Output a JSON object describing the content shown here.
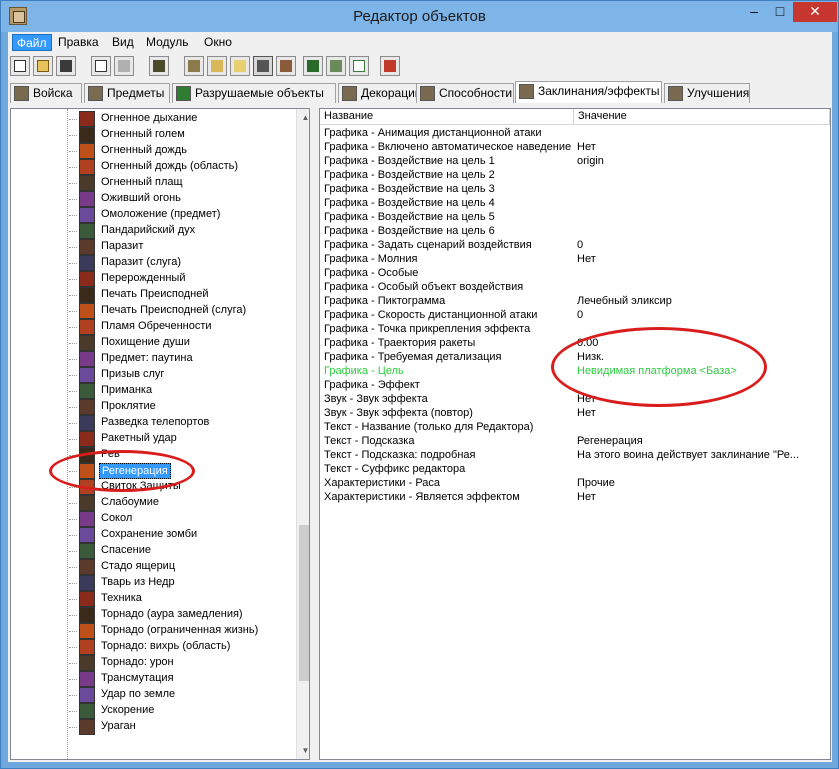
{
  "window": {
    "title": "Редактор объектов",
    "minimize": "–",
    "maximize": "□",
    "close": "✕"
  },
  "menu": [
    "Файл",
    "Правка",
    "Вид",
    "Модуль",
    "Окно"
  ],
  "toolbar_icons": [
    "new-icon",
    "open-icon",
    "save-icon",
    "copy-icon",
    "paste-icon",
    "units-icon",
    "terrain-icon",
    "script-icon",
    "sound-icon",
    "object-icon",
    "import-icon",
    "trigger-icon",
    "add-icon",
    "test-map-icon"
  ],
  "tabs": [
    {
      "label": "Войска",
      "icon": "units-tab-icon"
    },
    {
      "label": "Предметы",
      "icon": "items-tab-icon"
    },
    {
      "label": "Разрушаемые объекты",
      "icon": "destructibles-tab-icon"
    },
    {
      "label": "Декорации",
      "icon": "doodads-tab-icon"
    },
    {
      "label": "Способности",
      "icon": "abilities-tab-icon"
    },
    {
      "label": "Заклинания/эффекты",
      "icon": "buffs-tab-icon"
    },
    {
      "label": "Улучшения",
      "icon": "upgrades-tab-icon"
    }
  ],
  "selected_tab": 5,
  "tree": {
    "items": [
      "Огненное дыхание",
      "Огненный голем",
      "Огненный дождь",
      "Огненный дождь (область)",
      "Огненный плащ",
      "Оживший огонь",
      "Омоложение (предмет)",
      "Пандарийский дух",
      "Паразит",
      "Паразит (слуга)",
      "Перерожденный",
      "Печать Преисподней",
      "Печать Преисподней (слуга)",
      "Пламя Обреченности",
      "Похищение души",
      "Предмет: паутина",
      "Призыв слуг",
      "Приманка",
      "Проклятие",
      "Разведка телепортов",
      "Ракетный удар",
      "Рев",
      "Регенерация",
      "Свиток Защиты",
      "Слабоумие",
      "Сокол",
      "Сохранение зомби",
      "Спасение",
      "Стадо ящериц",
      "Тварь из Недр",
      "Техника",
      "Торнадо (аура замедления)",
      "Торнадо (ограниченная жизнь)",
      "Торнадо: вихрь (область)",
      "Торнадо: урон",
      "Трансмутация",
      "Удар по земле",
      "Ускорение",
      "Ураган"
    ],
    "selected_index": 22,
    "scroll_up": "▲",
    "scroll_down": "▼"
  },
  "table": {
    "columns": [
      "Название",
      "Значение"
    ],
    "rows": [
      {
        "name": "Графика - Анимация дистанционной атаки",
        "value": ""
      },
      {
        "name": "Графика - Включено автоматическое наведение",
        "value": "Нет"
      },
      {
        "name": "Графика - Воздействие на цель 1",
        "value": "origin"
      },
      {
        "name": "Графика - Воздействие на цель 2",
        "value": ""
      },
      {
        "name": "Графика - Воздействие на цель 3",
        "value": ""
      },
      {
        "name": "Графика - Воздействие на цель 4",
        "value": ""
      },
      {
        "name": "Графика - Воздействие на цель 5",
        "value": ""
      },
      {
        "name": "Графика - Воздействие на цель 6",
        "value": ""
      },
      {
        "name": "Графика - Задать сценарий воздействия",
        "value": "0"
      },
      {
        "name": "Графика - Молния",
        "value": "Нет"
      },
      {
        "name": "Графика - Особые",
        "value": ""
      },
      {
        "name": "Графика - Особый объект воздействия",
        "value": ""
      },
      {
        "name": "Графика - Пиктограмма",
        "value": "Лечебный эликсир"
      },
      {
        "name": "Графика - Скорость дистанционной атаки",
        "value": "0"
      },
      {
        "name": "Графика - Точка прикрепления эффекта",
        "value": ""
      },
      {
        "name": "Графика - Траектория ракеты",
        "value": "0.00"
      },
      {
        "name": "Графика - Требуемая детализация",
        "value": "Низк."
      },
      {
        "name": "Графика - Цель",
        "value": "Невидимая платформа <База>"
      },
      {
        "name": "Графика - Эффект",
        "value": ""
      },
      {
        "name": "Звук - Звук эффекта",
        "value": "Нет"
      },
      {
        "name": "Звук - Звук эффекта (повтор)",
        "value": "Нет"
      },
      {
        "name": "Текст - Название (только для Редактора)",
        "value": ""
      },
      {
        "name": "Текст - Подсказка",
        "value": "Регенерация"
      },
      {
        "name": "Текст - Подсказка: подробная",
        "value": "На этого воина действует заклинание \"Ре..."
      },
      {
        "name": "Текст - Суффикс редактора",
        "value": ""
      },
      {
        "name": "Характеристики - Раса",
        "value": "Прочие"
      },
      {
        "name": "Характеристики - Является эффектом",
        "value": "Нет"
      }
    ],
    "highlight_row": 17,
    "highlight_color": "#2ecc40"
  },
  "annotation_color": "#d91c1c"
}
